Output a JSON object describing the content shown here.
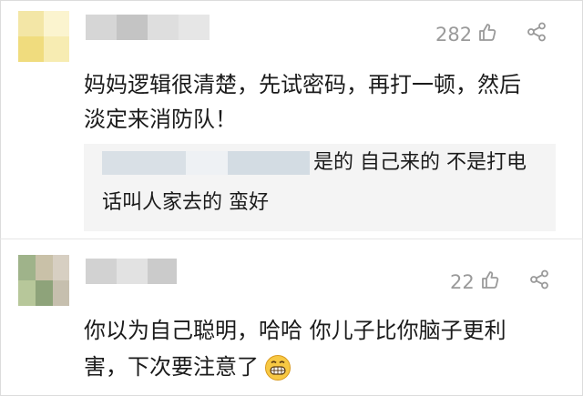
{
  "comments": [
    {
      "likes": "282",
      "text_line1": "妈妈逻辑很清楚，先试密码，再打一顿，然后",
      "text_line2": "淡定来消防队！",
      "reply": {
        "text_line1": "是的 自己来的 不是打电",
        "text_line2": "话叫人家去的 蛮好"
      }
    },
    {
      "likes": "22",
      "text_line1": "你以为自己聪明，哈哈 你儿子比你脑子更利",
      "text_line2": "害，下次要注意了"
    }
  ],
  "icons": {
    "like": "thumbs-up-icon",
    "share": "share-icon",
    "emoji": "grinning-face-icon"
  },
  "colors": {
    "meta_gray": "#9a9a9a",
    "reply_bg": "#f4f4f4",
    "avatar1_primary": "#f2e08a",
    "avatar2_primary": "#b7c79a"
  }
}
